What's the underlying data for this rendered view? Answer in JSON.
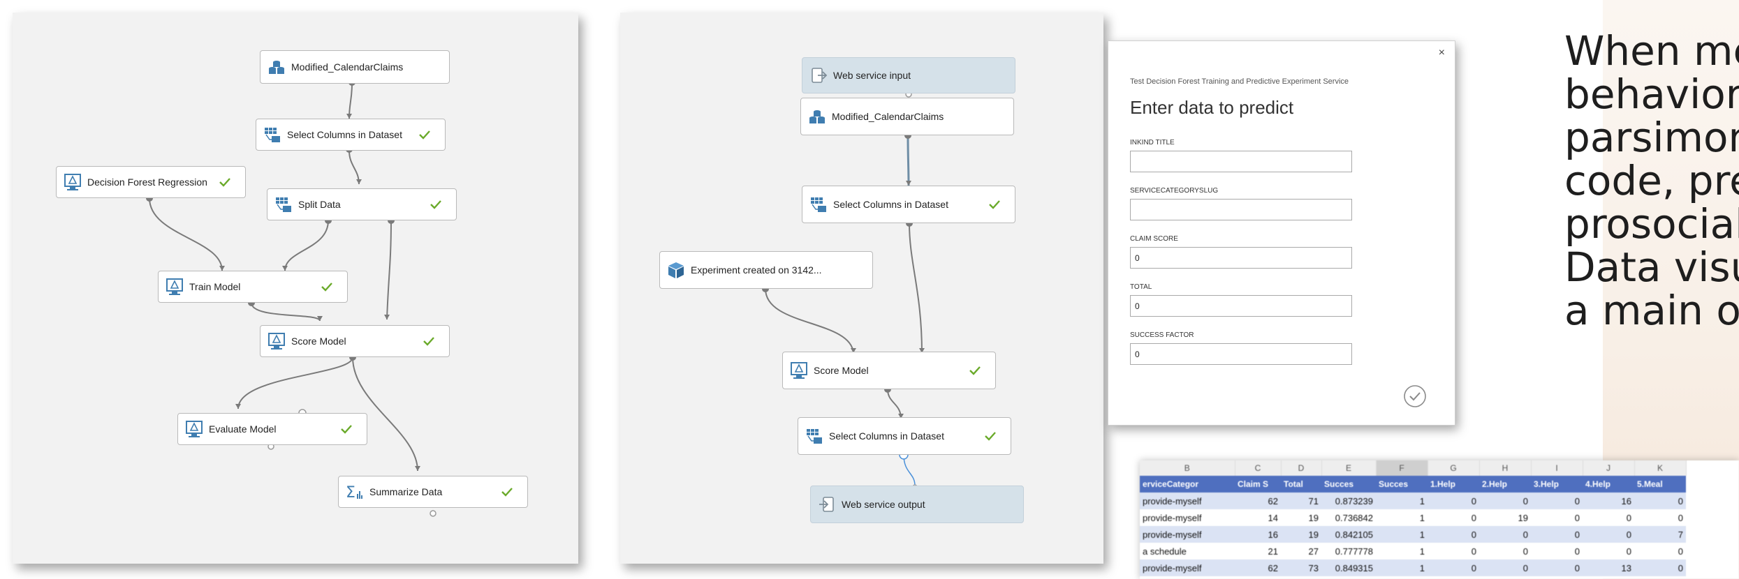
{
  "canvas1": {
    "nodes": [
      {
        "name": "node-modified-calendar-claims",
        "label": "Modified_CalendarClaims",
        "icon": "dataset-icon",
        "check": false
      },
      {
        "name": "node-select-columns",
        "label": "Select Columns in Dataset",
        "icon": "select-columns-icon",
        "check": true
      },
      {
        "name": "node-decision-forest-regression",
        "label": "Decision Forest Regression",
        "icon": "model-icon",
        "check": true
      },
      {
        "name": "node-split-data",
        "label": "Split Data",
        "icon": "select-columns-icon",
        "check": true
      },
      {
        "name": "node-train-model",
        "label": "Train Model",
        "icon": "model-icon",
        "check": true
      },
      {
        "name": "node-score-model",
        "label": "Score Model",
        "icon": "model-icon",
        "check": true
      },
      {
        "name": "node-evaluate-model",
        "label": "Evaluate Model",
        "icon": "model-icon",
        "check": true
      },
      {
        "name": "node-summarize-data",
        "label": "Summarize Data",
        "icon": "sigma-icon",
        "check": true
      }
    ]
  },
  "canvas2": {
    "nodes": [
      {
        "name": "node-web-service-input",
        "label": "Web service input",
        "icon": "web-input-icon",
        "check": false,
        "ws": true
      },
      {
        "name": "node-modified-calendar-claims",
        "label": "Modified_CalendarClaims",
        "icon": "dataset-icon",
        "check": false
      },
      {
        "name": "node-select-columns",
        "label": "Select Columns in Dataset",
        "icon": "select-columns-icon",
        "check": true
      },
      {
        "name": "node-experiment-created",
        "label": "Experiment created on 3142...",
        "icon": "cube-icon",
        "check": false
      },
      {
        "name": "node-score-model",
        "label": "Score Model",
        "icon": "model-icon",
        "check": true
      },
      {
        "name": "node-select-columns-2",
        "label": "Select Columns in Dataset",
        "icon": "select-columns-icon",
        "check": true
      },
      {
        "name": "node-web-service-output",
        "label": "Web service output",
        "icon": "web-output-icon",
        "check": false,
        "ws": true
      }
    ]
  },
  "dialog": {
    "close": "×",
    "service_name": "Test Decision Forest Training and Predictive Experiment Service",
    "title": "Enter data to predict",
    "fields": [
      {
        "label": "INKIND TITLE",
        "value": ""
      },
      {
        "label": "SERVICECATEGORYSLUG",
        "value": ""
      },
      {
        "label": "CLAIM SCORE",
        "value": "0"
      },
      {
        "label": "TOTAL",
        "value": "0"
      },
      {
        "label": "SUCCESS FACTOR",
        "value": "0"
      }
    ],
    "ok_icon": "check-circle-icon"
  },
  "slide_text": {
    "lines": [
      "When me",
      "behavior,",
      "parsimon",
      "code, pre",
      "prosocial",
      "Data visu",
      "a main ob"
    ]
  },
  "spreadsheet": {
    "column_letters": [
      "B",
      "C",
      "D",
      "E",
      "F",
      "G",
      "H",
      "I",
      "J",
      "K"
    ],
    "selected_column": "F",
    "headers": [
      "erviceCategor",
      "Claim S",
      "Total",
      "Succes",
      "Succes",
      "1.Help",
      "2.Help",
      "3.Help",
      "4.Help",
      "5.Meal"
    ],
    "rows": [
      [
        "provide-myself",
        "62",
        "71",
        "0.873239",
        "1",
        "0",
        "0",
        "0",
        "16",
        "0"
      ],
      [
        "provide-myself",
        "14",
        "19",
        "0.736842",
        "1",
        "0",
        "19",
        "0",
        "0",
        "0"
      ],
      [
        "provide-myself",
        "16",
        "19",
        "0.842105",
        "1",
        "0",
        "0",
        "0",
        "0",
        "7"
      ],
      [
        "a schedule",
        "21",
        "27",
        "0.777778",
        "1",
        "0",
        "0",
        "0",
        "0",
        "0"
      ],
      [
        "provide-myself",
        "62",
        "73",
        "0.849315",
        "1",
        "0",
        "0",
        "0",
        "13",
        "0"
      ]
    ]
  },
  "colors": {
    "check": "#6aaa2a",
    "wire": "#7a7a7a",
    "port": "#6f6f6f",
    "icon": "#3f7db0",
    "ws_fill": "#d5e1e9"
  }
}
